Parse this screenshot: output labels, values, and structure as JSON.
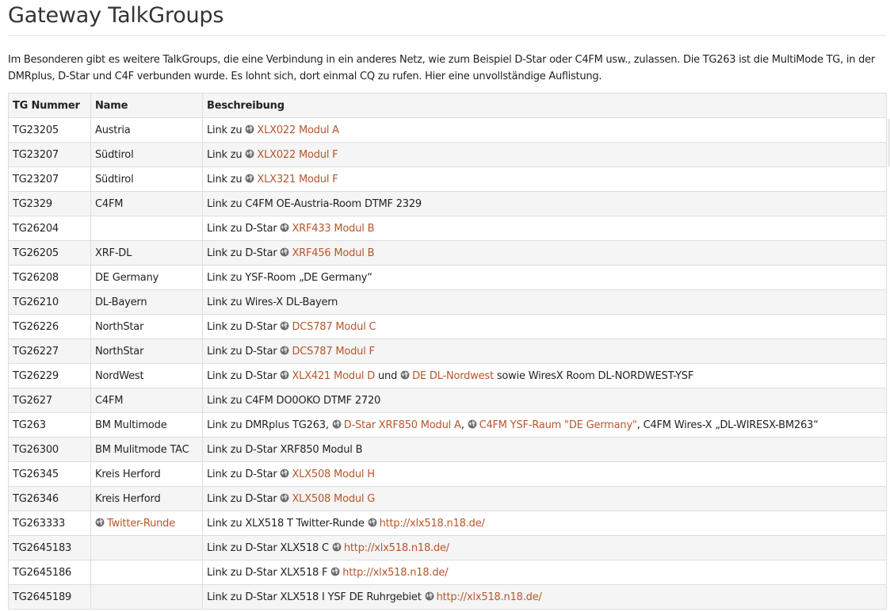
{
  "page": {
    "title": "Gateway TalkGroups",
    "intro": "Im Besonderen gibt es weitere TalkGroups, die eine Verbindung in ein anderes Netz, wie zum Beispiel D-Star oder C4FM usw., zulassen. Die TG263 ist die MultiMode TG, in der DMRplus, D-Star und C4F verbunden wurde. Es lohnt sich, dort einmal CQ zu rufen. Hier eine unvollständige Auflistung."
  },
  "table": {
    "headers": [
      "TG Nummer",
      "Name",
      "Beschreibung"
    ],
    "rows": [
      {
        "tg": "TG23205",
        "name": [
          {
            "t": "text",
            "v": "Austria"
          }
        ],
        "desc": [
          {
            "t": "text",
            "v": "Link zu "
          },
          {
            "t": "link",
            "v": "XLX022 Modul A"
          }
        ]
      },
      {
        "tg": "TG23207",
        "name": [
          {
            "t": "text",
            "v": "Südtirol"
          }
        ],
        "desc": [
          {
            "t": "text",
            "v": "Link zu "
          },
          {
            "t": "link",
            "v": "XLX022 Modul F"
          }
        ]
      },
      {
        "tg": "TG23207",
        "name": [
          {
            "t": "text",
            "v": "Südtirol"
          }
        ],
        "desc": [
          {
            "t": "text",
            "v": "Link zu "
          },
          {
            "t": "link",
            "v": "XLX321 Modul F"
          }
        ]
      },
      {
        "tg": "TG2329",
        "name": [
          {
            "t": "text",
            "v": "C4FM"
          }
        ],
        "desc": [
          {
            "t": "text",
            "v": "Link zu C4FM OE-Austria-Room DTMF 2329"
          }
        ]
      },
      {
        "tg": "TG26204",
        "name": [],
        "desc": [
          {
            "t": "text",
            "v": "Link zu D-Star "
          },
          {
            "t": "link",
            "v": "XRF433 Modul B"
          }
        ]
      },
      {
        "tg": "TG26205",
        "name": [
          {
            "t": "text",
            "v": "XRF-DL"
          }
        ],
        "desc": [
          {
            "t": "text",
            "v": "Link zu D-Star "
          },
          {
            "t": "link",
            "v": "XRF456 Modul B"
          }
        ]
      },
      {
        "tg": "TG26208",
        "name": [
          {
            "t": "text",
            "v": "DE Germany"
          }
        ],
        "desc": [
          {
            "t": "text",
            "v": "Link zu YSF-Room „DE Germany“"
          }
        ]
      },
      {
        "tg": "TG26210",
        "name": [
          {
            "t": "text",
            "v": "DL-Bayern"
          }
        ],
        "desc": [
          {
            "t": "text",
            "v": "Link zu Wires-X DL-Bayern"
          }
        ]
      },
      {
        "tg": "TG26226",
        "name": [
          {
            "t": "text",
            "v": "NorthStar"
          }
        ],
        "desc": [
          {
            "t": "text",
            "v": "Link zu D-Star "
          },
          {
            "t": "link",
            "v": "DCS787 Modul C"
          }
        ]
      },
      {
        "tg": "TG26227",
        "name": [
          {
            "t": "text",
            "v": "NorthStar"
          }
        ],
        "desc": [
          {
            "t": "text",
            "v": "Link zu D-Star "
          },
          {
            "t": "link",
            "v": "DCS787 Modul F"
          }
        ]
      },
      {
        "tg": "TG26229",
        "name": [
          {
            "t": "text",
            "v": "NordWest"
          }
        ],
        "desc": [
          {
            "t": "text",
            "v": "Link zu D-Star "
          },
          {
            "t": "link",
            "v": "XLX421 Modul D"
          },
          {
            "t": "text",
            "v": " und "
          },
          {
            "t": "link",
            "v": "DE DL-Nordwest"
          },
          {
            "t": "text",
            "v": " sowie WiresX Room DL-NORDWEST-YSF"
          }
        ]
      },
      {
        "tg": "TG2627",
        "name": [
          {
            "t": "text",
            "v": "C4FM"
          }
        ],
        "desc": [
          {
            "t": "text",
            "v": "Link zu C4FM DO0OKO DTMF 2720"
          }
        ]
      },
      {
        "tg": "TG263",
        "name": [
          {
            "t": "text",
            "v": "BM Multimode"
          }
        ],
        "desc": [
          {
            "t": "text",
            "v": "Link zu DMRplus TG263, "
          },
          {
            "t": "link",
            "v": "D-Star XRF850 Modul A"
          },
          {
            "t": "text",
            "v": ", "
          },
          {
            "t": "link",
            "v": "C4FM YSF-Raum \"DE Germany\""
          },
          {
            "t": "text",
            "v": ", C4FM Wires-X „DL-WIRESX-BM263“"
          }
        ]
      },
      {
        "tg": "TG26300",
        "name": [
          {
            "t": "text",
            "v": "BM Mulitmode TAC"
          }
        ],
        "desc": [
          {
            "t": "text",
            "v": "Link zu D-Star XRF850 Modul B"
          }
        ]
      },
      {
        "tg": "TG26345",
        "name": [
          {
            "t": "text",
            "v": "Kreis Herford"
          }
        ],
        "desc": [
          {
            "t": "text",
            "v": "Link zu D-Star "
          },
          {
            "t": "link",
            "v": "XLX508 Modul H"
          }
        ]
      },
      {
        "tg": "TG26346",
        "name": [
          {
            "t": "text",
            "v": "Kreis Herford"
          }
        ],
        "desc": [
          {
            "t": "text",
            "v": "Link zu D-Star "
          },
          {
            "t": "link",
            "v": "XLX508 Modul G"
          }
        ]
      },
      {
        "tg": "TG263333",
        "name": [
          {
            "t": "link",
            "v": "Twitter-Runde"
          }
        ],
        "desc": [
          {
            "t": "text",
            "v": "Link zu XLX518 T Twitter-Runde "
          },
          {
            "t": "link",
            "v": "http://xlx518.n18.de/"
          }
        ]
      },
      {
        "tg": "TG2645183",
        "name": [],
        "desc": [
          {
            "t": "text",
            "v": "Link zu D-Star XLX518 C "
          },
          {
            "t": "link",
            "v": "http://xlx518.n18.de/"
          }
        ]
      },
      {
        "tg": "TG2645186",
        "name": [],
        "desc": [
          {
            "t": "text",
            "v": "Link zu D-Star XLX518 F "
          },
          {
            "t": "link",
            "v": "http://xlx518.n18.de/"
          }
        ]
      },
      {
        "tg": "TG2645189",
        "name": [],
        "desc": [
          {
            "t": "text",
            "v": "Link zu D-Star XLX518 I YSF DE Ruhrgebiet "
          },
          {
            "t": "link",
            "v": "http://xlx518.n18.de/"
          }
        ]
      }
    ]
  },
  "icons": {
    "external_link": "globe-icon"
  },
  "colors": {
    "link": "#b5562b",
    "row_alt": "#f5f5f5",
    "border": "#dddddd"
  }
}
